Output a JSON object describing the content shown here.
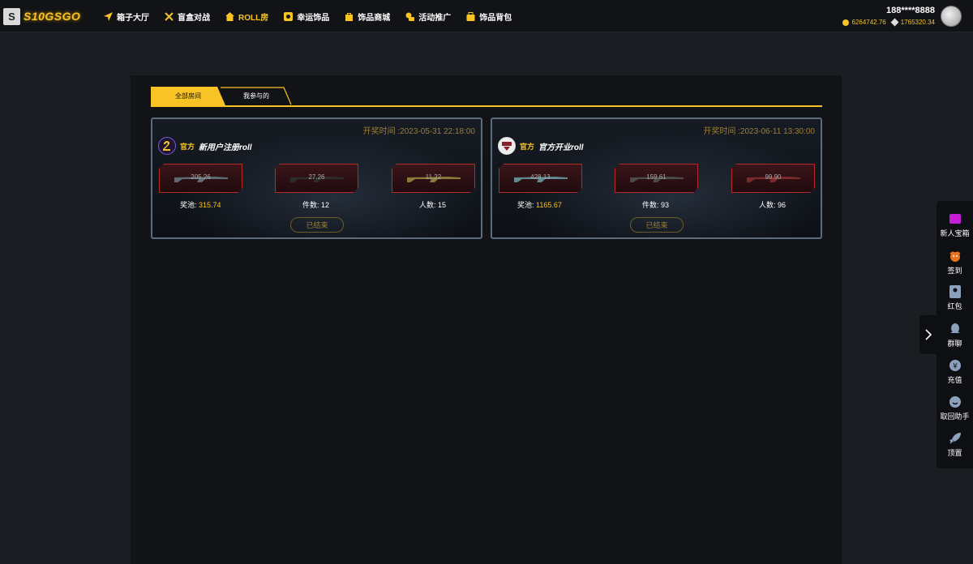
{
  "header": {
    "logo_letter": "S",
    "logo_text": "S10GSGO",
    "nav": [
      {
        "label": "箱子大厅",
        "icon": "paper-plane-icon"
      },
      {
        "label": "盲盒对战",
        "icon": "crossed-swords-icon"
      },
      {
        "label": "ROLL房",
        "icon": "house-icon",
        "active": true
      },
      {
        "label": "幸运饰品",
        "icon": "lucky-icon"
      },
      {
        "label": "饰品商城",
        "icon": "shopping-bag-icon"
      },
      {
        "label": "活动推广",
        "icon": "coins-icon"
      },
      {
        "label": "饰品背包",
        "icon": "backpack-icon"
      }
    ],
    "user": {
      "name": "188****8888",
      "coins": "6264742.76",
      "diamonds": "1765320.34"
    }
  },
  "tabs": {
    "all": "全部房间",
    "mine": "我参与的"
  },
  "rooms": [
    {
      "time": "开奖时间 :2023-05-31 22:18:00",
      "badge": "官方",
      "title": "新用户注册roll",
      "items": [
        "205.26",
        "27.26",
        "11.22"
      ],
      "pool_label": "奖池:",
      "pool_value": "315.74",
      "count_label": "件数:",
      "count_value": "12",
      "people_label": "人数:",
      "people_value": "15",
      "status": "已结束"
    },
    {
      "time": "开奖时间 :2023-06-11 13:30:00",
      "badge": "官方",
      "title": "官方开业roll",
      "items": [
        "428.13",
        "159.61",
        "99.90"
      ],
      "pool_label": "奖池:",
      "pool_value": "1165.67",
      "count_label": "件数:",
      "count_value": "93",
      "people_label": "人数:",
      "people_value": "96",
      "status": "已结束"
    }
  ],
  "dock": [
    {
      "label": "新人宝箱",
      "icon": "gift-box-icon"
    },
    {
      "label": "签到",
      "icon": "sign-in-icon"
    },
    {
      "label": "红包",
      "icon": "red-envelope-icon"
    },
    {
      "label": "群聊",
      "icon": "qq-chat-icon"
    },
    {
      "label": "充值",
      "icon": "recharge-icon"
    },
    {
      "label": "取回助手",
      "icon": "helper-icon"
    },
    {
      "label": "顶置",
      "icon": "rocket-icon"
    }
  ],
  "colors": {
    "accent": "#f7c325",
    "background": "#1b1d23",
    "panel": "#111317",
    "item_border": "#b32a2a"
  }
}
